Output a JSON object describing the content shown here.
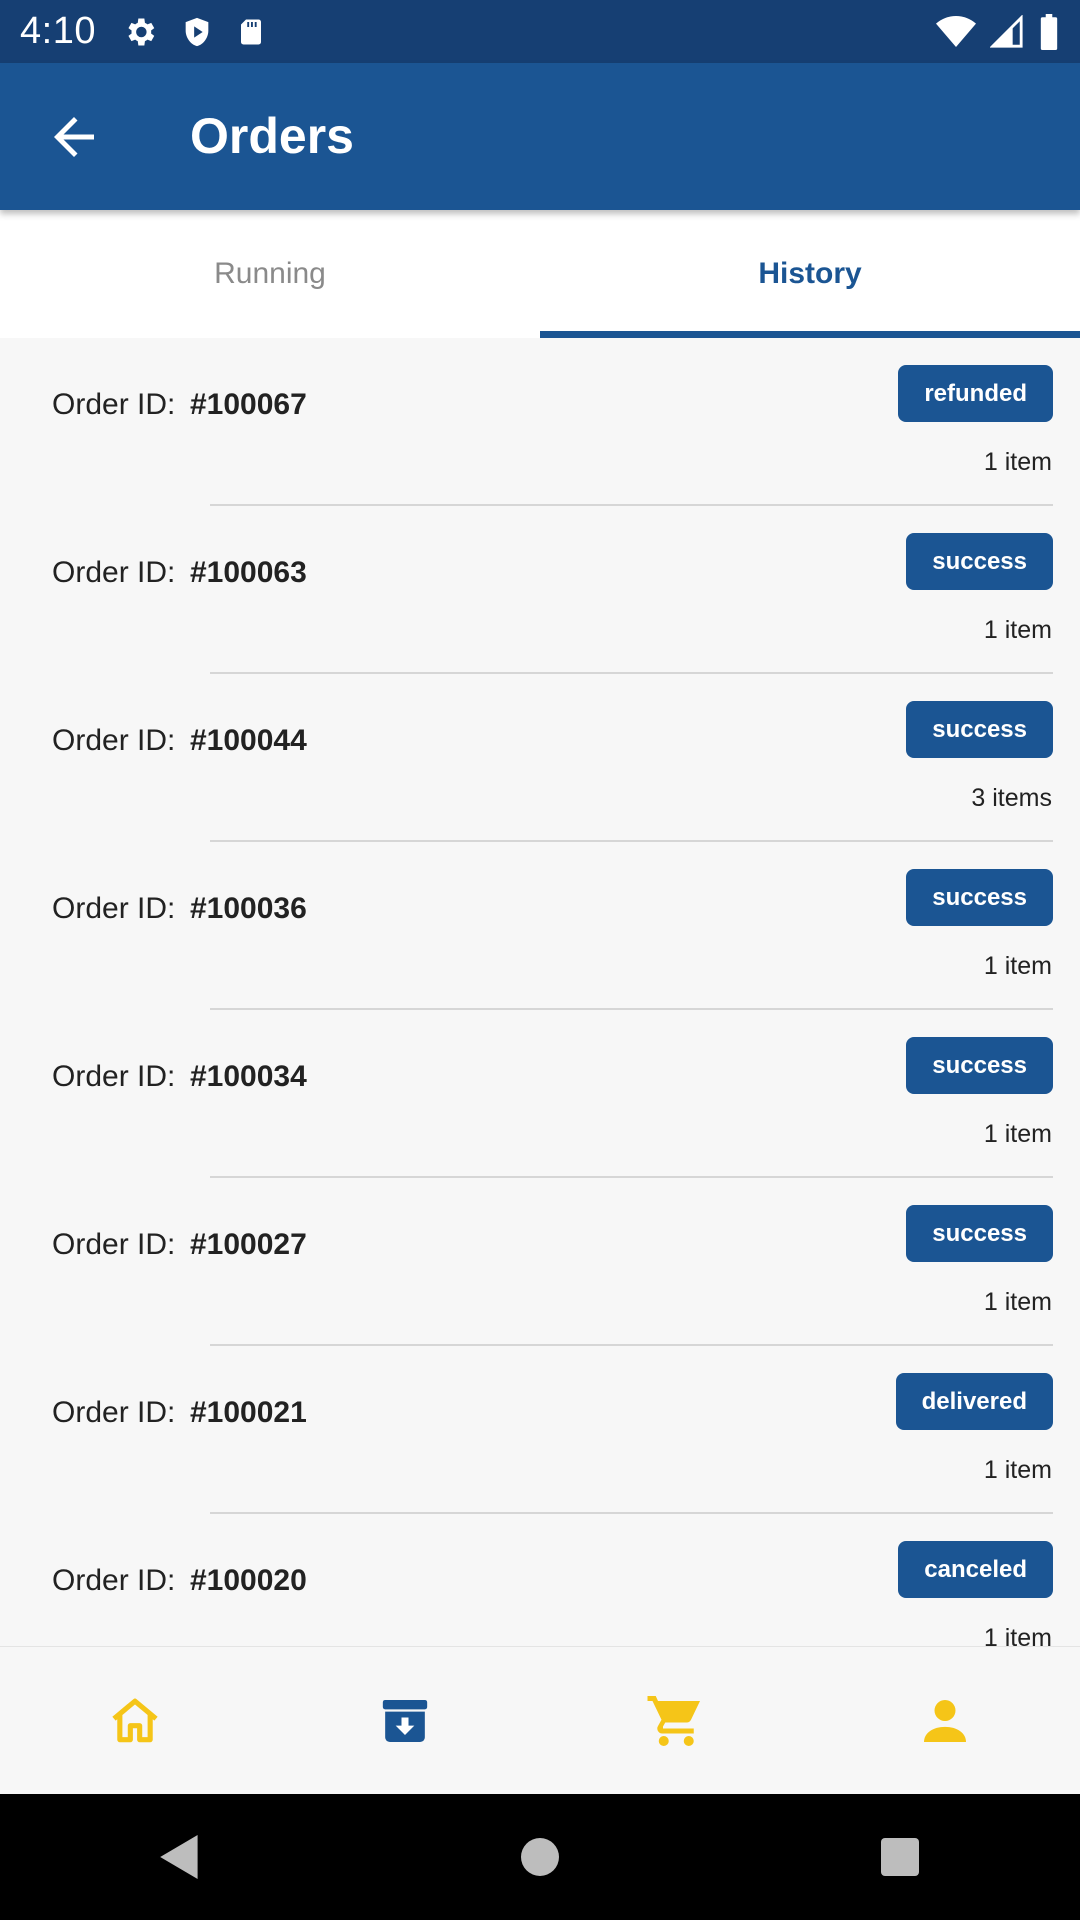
{
  "status_bar": {
    "time": "4:10",
    "icons": [
      "gear-icon",
      "shield-play-icon",
      "sd-card-icon",
      "wifi-icon",
      "signal-icon",
      "battery-icon"
    ]
  },
  "app_bar": {
    "title": "Orders",
    "back_icon": "arrow-back-icon"
  },
  "tabs": [
    {
      "label": "Running",
      "active": false
    },
    {
      "label": "History",
      "active": true
    }
  ],
  "order_id_label": "Order ID:",
  "orders": [
    {
      "id": "#100067",
      "status": "refunded",
      "items": "1 item"
    },
    {
      "id": "#100063",
      "status": "success",
      "items": "1 item"
    },
    {
      "id": "#100044",
      "status": "success",
      "items": "3 items"
    },
    {
      "id": "#100036",
      "status": "success",
      "items": "1 item"
    },
    {
      "id": "#100034",
      "status": "success",
      "items": "1 item"
    },
    {
      "id": "#100027",
      "status": "success",
      "items": "1 item"
    },
    {
      "id": "#100021",
      "status": "delivered",
      "items": "1 item"
    },
    {
      "id": "#100020",
      "status": "canceled",
      "items": "1 item"
    }
  ],
  "bottom_nav": [
    {
      "icon": "home-icon",
      "active": false
    },
    {
      "icon": "orders-box-icon",
      "active": true
    },
    {
      "icon": "cart-icon",
      "active": false
    },
    {
      "icon": "person-icon",
      "active": false
    }
  ],
  "colors": {
    "primary": "#1b5593",
    "status_bar": "#163f73",
    "accent": "#f5c518",
    "background": "#f7f7f7"
  }
}
